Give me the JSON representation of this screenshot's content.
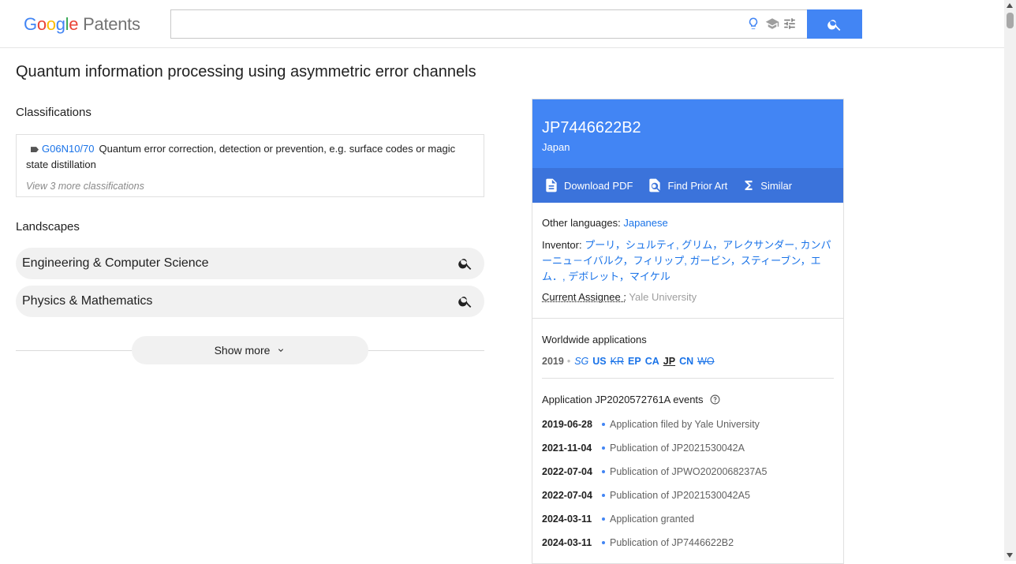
{
  "header": {
    "logo_google": [
      "G",
      "o",
      "o",
      "g",
      "l",
      "e"
    ],
    "logo_patents": "Patents",
    "search_placeholder": ""
  },
  "title": "Quantum information processing using asymmetric error channels",
  "classifications": {
    "heading": "Classifications",
    "code": "G06N10/70",
    "description": "Quantum error correction, detection or prevention, e.g. surface codes or magic state distillation",
    "view_more": "View 3 more classifications"
  },
  "landscapes": {
    "heading": "Landscapes",
    "items": [
      "Engineering & Computer Science",
      "Physics & Mathematics"
    ],
    "show_more": "Show more"
  },
  "card": {
    "pub_number": "JP7446622B2",
    "country": "Japan",
    "actions": [
      "Download PDF",
      "Find Prior Art",
      "Similar"
    ],
    "other_languages_label": "Other languages:",
    "other_languages_value": "Japanese",
    "inventor_label": "Inventor:",
    "inventor_value": "プーリ，シュルティ, グリム，アレクサンダー, カンパーニュ－イバルク，フィリップ, ガービン，スティーブン，エム．, デボレット，マイケル",
    "assignee_label": "Current Assignee :",
    "assignee_value": "Yale University",
    "worldwide_heading": "Worldwide applications",
    "worldwide_year": "2019",
    "worldwide_dot": "•",
    "worldwide_codes": [
      "SG",
      "US",
      "KR",
      "EP",
      "CA",
      "JP",
      "CN",
      "WO"
    ],
    "events_heading": "Application JP2020572761A events",
    "events": [
      {
        "date": "2019-06-28",
        "text": "Application filed by Yale University"
      },
      {
        "date": "2021-11-04",
        "text": "Publication of JP2021530042A"
      },
      {
        "date": "2022-07-04",
        "text": "Publication of JPWO2020068237A5"
      },
      {
        "date": "2022-07-04",
        "text": "Publication of JP2021530042A5"
      },
      {
        "date": "2024-03-11",
        "text": "Application granted"
      },
      {
        "date": "2024-03-11",
        "text": "Publication of JP7446622B2"
      }
    ]
  },
  "colors": {
    "accent": "#4285f4",
    "accent_dark": "#3b73db",
    "link": "#1a73e8"
  }
}
